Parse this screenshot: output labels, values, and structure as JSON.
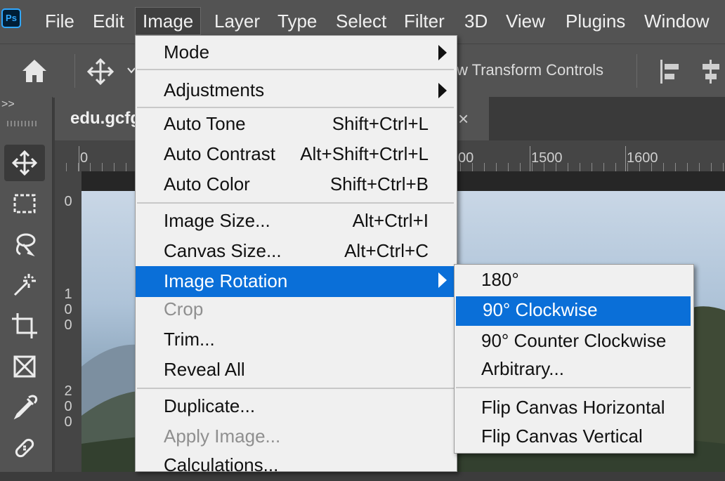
{
  "app": {
    "logo_text": "Ps"
  },
  "menubar": {
    "items": [
      "File",
      "Edit",
      "Image",
      "Layer",
      "Type",
      "Select",
      "Filter",
      "3D",
      "View",
      "Plugins",
      "Window"
    ],
    "active": "Image"
  },
  "options_bar": {
    "transform_text": "w Transform Controls"
  },
  "toolbar": {
    "collapse_glyph": ">>",
    "tools": [
      "move-tool",
      "marquee-tool",
      "lasso-tool",
      "magic-wand-tool",
      "crop-tool",
      "frame-tool",
      "eyedropper-tool",
      "healing-brush-tool"
    ]
  },
  "document": {
    "tab_title": "edu.gcfg",
    "close_glyph": "×"
  },
  "rulers": {
    "h_labels": [
      "0",
      "00",
      "1500",
      "1600"
    ],
    "v_labels": [
      [
        "0"
      ],
      [
        "1",
        "0",
        "0"
      ],
      [
        "2",
        "0",
        "0"
      ]
    ]
  },
  "image_menu": {
    "items": [
      {
        "label": "Mode",
        "shortcut": "",
        "submenu": true
      },
      {
        "label": "Adjustments",
        "shortcut": "",
        "submenu": true
      },
      {
        "label": "Auto Tone",
        "shortcut": "Shift+Ctrl+L"
      },
      {
        "label": "Auto Contrast",
        "shortcut": "Alt+Shift+Ctrl+L"
      },
      {
        "label": "Auto Color",
        "shortcut": "Shift+Ctrl+B"
      },
      {
        "label": "Image Size...",
        "shortcut": "Alt+Ctrl+I"
      },
      {
        "label": "Canvas Size...",
        "shortcut": "Alt+Ctrl+C"
      },
      {
        "label": "Image Rotation",
        "shortcut": "",
        "submenu": true,
        "highlighted": true
      },
      {
        "label": "Crop",
        "shortcut": "",
        "disabled": true
      },
      {
        "label": "Trim...",
        "shortcut": ""
      },
      {
        "label": "Reveal All",
        "shortcut": ""
      },
      {
        "label": "Duplicate...",
        "shortcut": ""
      },
      {
        "label": "Apply Image...",
        "shortcut": "",
        "disabled": true
      },
      {
        "label": "Calculations...",
        "shortcut": ""
      }
    ]
  },
  "rotation_submenu": {
    "items": [
      {
        "label": "180°"
      },
      {
        "label": "90° Clockwise",
        "highlighted": true
      },
      {
        "label": "90° Counter Clockwise"
      },
      {
        "label": "Arbitrary..."
      },
      {
        "label": "Flip Canvas Horizontal"
      },
      {
        "label": "Flip Canvas Vertical"
      }
    ]
  },
  "colors": {
    "highlight": "#0a6fd8",
    "menu_bg": "#f0f0f0",
    "chrome": "#535353"
  }
}
